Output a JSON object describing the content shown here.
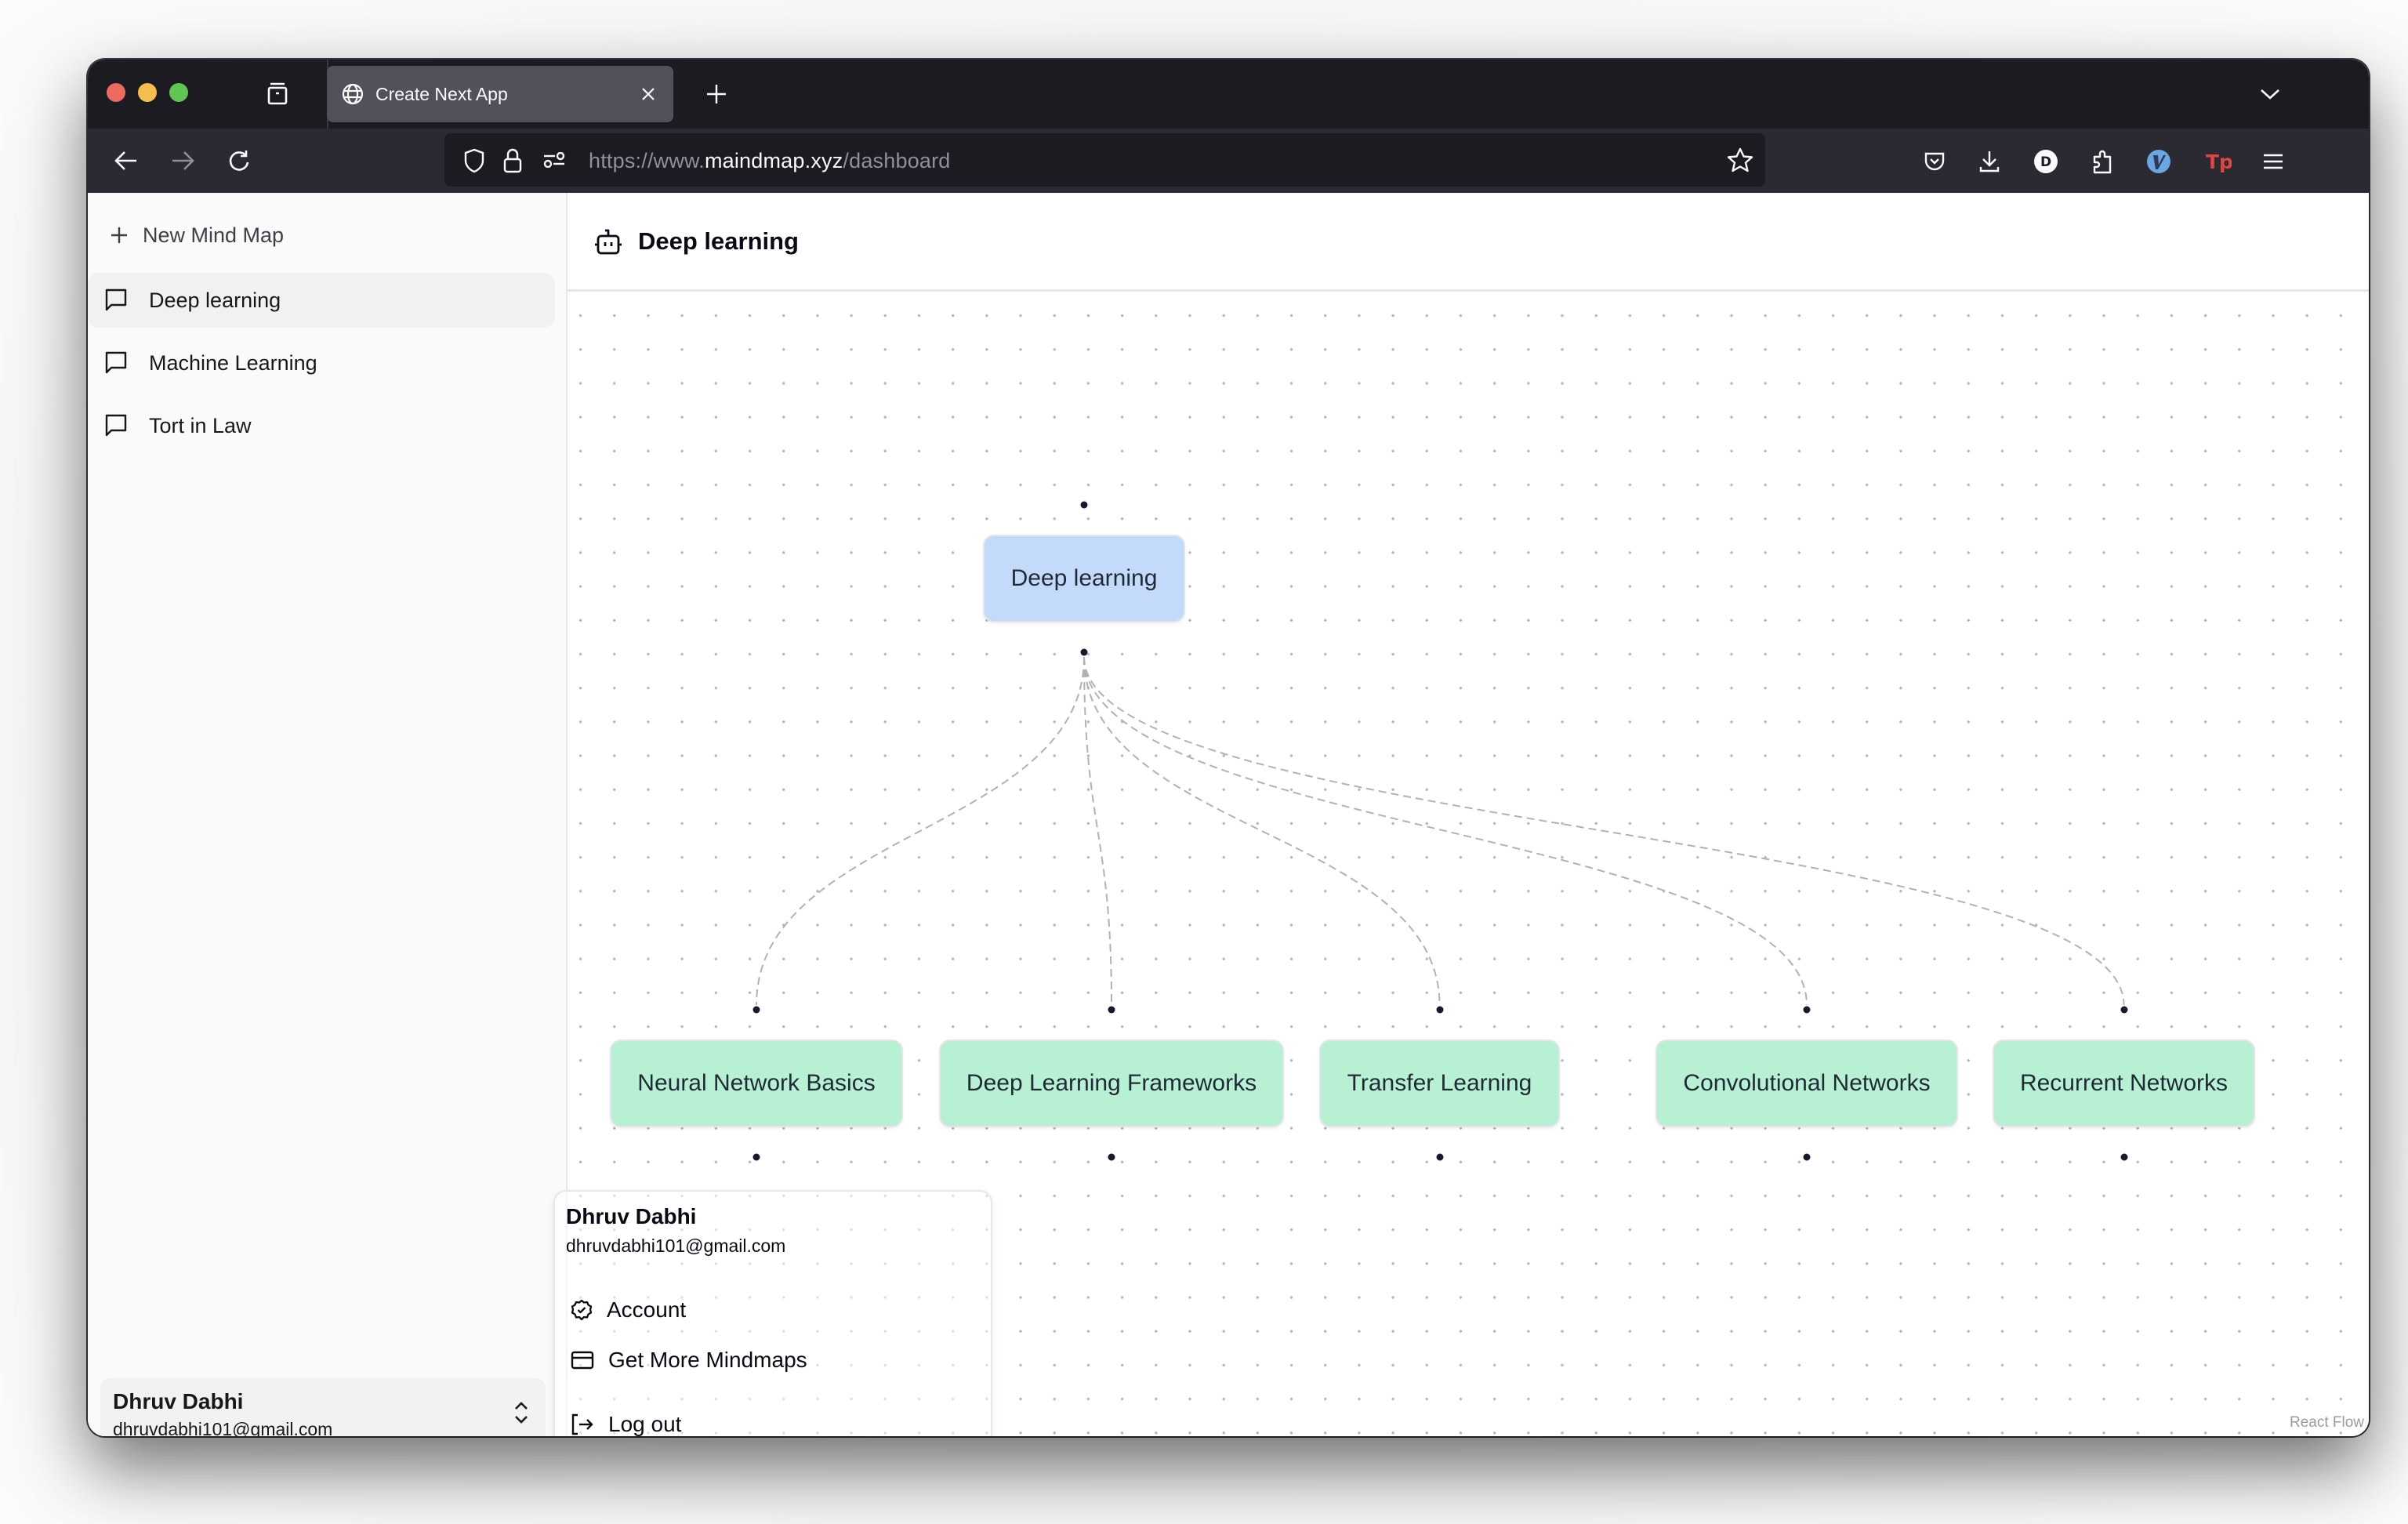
{
  "browser": {
    "tab_title": "Create Next App",
    "url": {
      "prefix": "https://www.",
      "host": "maindmap.xyz",
      "path": "/dashboard"
    },
    "toolbar_icons": [
      "pocket-icon",
      "download-icon",
      "d-extension-icon",
      "extensions-icon",
      "v-extension-icon",
      "tp-extension-icon",
      "menu-icon"
    ],
    "colors": {
      "tabbar_bg": "#1c1b22",
      "navbar_bg": "#2b2a33",
      "active_tab_bg": "#52515b",
      "traffic_red": "#ec6a5e",
      "traffic_yellow": "#f4bf4f",
      "traffic_green": "#61c554"
    }
  },
  "sidebar": {
    "new_button_label": "New Mind Map",
    "items": [
      {
        "label": "Deep learning",
        "active": true
      },
      {
        "label": "Machine Learning",
        "active": false
      },
      {
        "label": "Tort in Law",
        "active": false
      }
    ],
    "user": {
      "name": "Dhruv Dabhi",
      "email": "dhruvdabhi101@gmail.com"
    }
  },
  "main": {
    "title": "Deep learning"
  },
  "mindmap": {
    "root": {
      "label": "Deep learning",
      "color": "#c3dafa"
    },
    "children": [
      {
        "label": "Neural Network Basics"
      },
      {
        "label": "Deep Learning Frameworks"
      },
      {
        "label": "Transfer Learning"
      },
      {
        "label": "Convolutional Networks"
      },
      {
        "label": "Recurrent Networks"
      }
    ],
    "child_color": "#b8f0d3",
    "edge_style": "dashed"
  },
  "user_menu": {
    "name": "Dhruv Dabhi",
    "email": "dhruvdabhi101@gmail.com",
    "items": [
      {
        "label": "Account",
        "icon": "badge-check-icon"
      },
      {
        "label": "Get More Mindmaps",
        "icon": "credit-card-icon"
      },
      {
        "label": "Log out",
        "icon": "log-out-icon"
      }
    ]
  },
  "attribution": "React Flow"
}
